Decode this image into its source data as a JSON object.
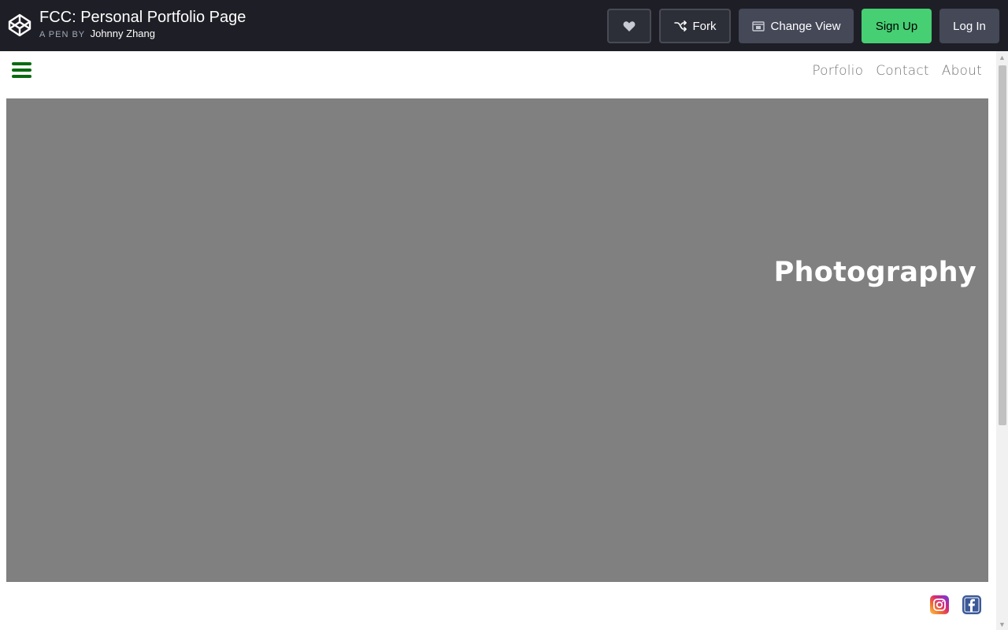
{
  "codepen": {
    "title": "FCC: Personal Portfolio Page",
    "byline_prefix": "A PEN BY",
    "author": "Johnny Zhang",
    "buttons": {
      "fork": "Fork",
      "change_view": "Change View",
      "sign_up": "Sign Up",
      "log_in": "Log In"
    },
    "icons": {
      "logo": "codepen-logo-icon",
      "heart": "heart-icon",
      "fork": "fork-icon",
      "change_view": "change-view-icon"
    },
    "colors": {
      "bar": "#1e1f26",
      "signup": "#47cf73",
      "secondary_button": "#444857"
    }
  },
  "site": {
    "nav": [
      "Porfolio",
      "Contact",
      "About"
    ],
    "hero_title": "Photography",
    "icons": {
      "menu": "hamburger-menu-icon",
      "instagram": "instagram-icon",
      "facebook": "facebook-icon"
    },
    "colors": {
      "hero_bg": "#808080",
      "menu": "#0a6b10",
      "nav_text": "#757575"
    }
  }
}
